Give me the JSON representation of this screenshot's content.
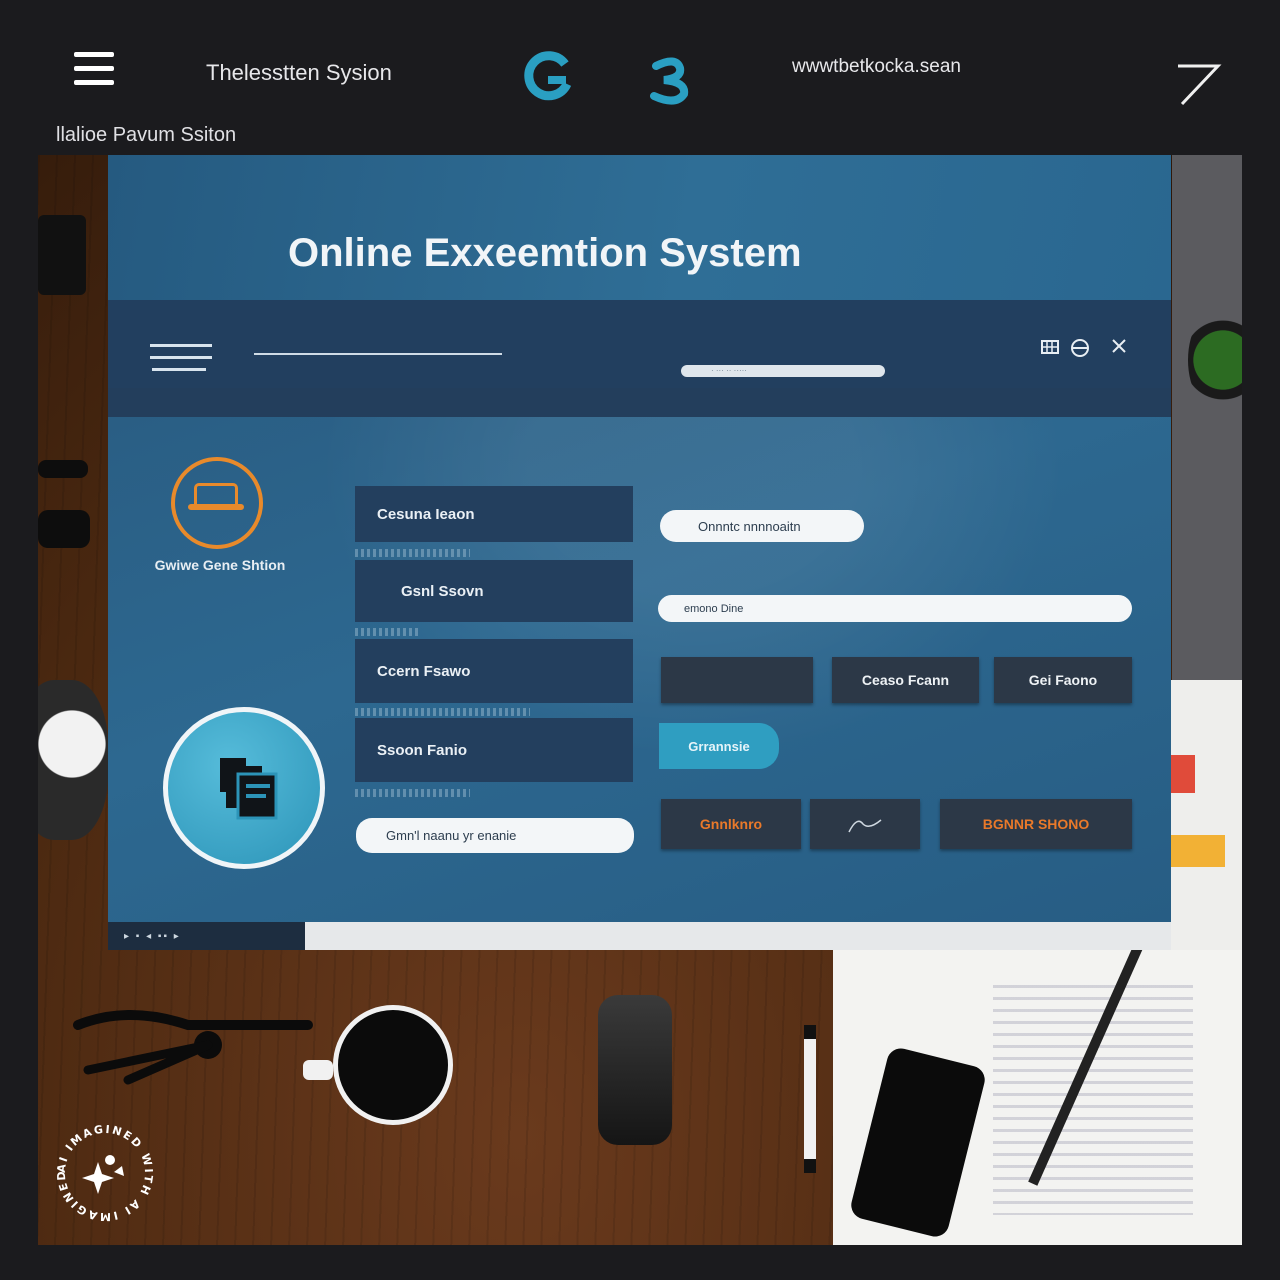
{
  "topbar": {
    "app_title": "Thelesstten Sysion",
    "site_url": "wwwtbetkocka.sean",
    "subtitle": "llalioe Pavum Ssiton"
  },
  "window": {
    "title": "Online Exxeemtion System",
    "nav_search_placeholder": "· ···  ··  ·····",
    "nav_icons": [
      "grid-icon",
      "globe-icon",
      "close-icon"
    ]
  },
  "left_panel": {
    "logo_label": "Gwiwe Gene Shtion",
    "logo_icon": "graduation-cap-icon",
    "feature_icon": "document-stack-icon"
  },
  "menu": {
    "items": [
      "Cesuna Ieaon",
      "Gsnl Ssovn",
      "Ccern Fsawo",
      "Ssoon Fanio"
    ],
    "bottom_pill": "Gmn'l naanu yr enanie"
  },
  "form": {
    "pill_button": "Onnntc nnnnoaitn",
    "input_value": "emono Dine",
    "row1": [
      "",
      "Ceaso Fcann",
      "Gei Faono"
    ],
    "teal_button": "Grrannsie",
    "row3_left": "Gnnlknro",
    "row3_right": "BGNNR  SHONO"
  },
  "status_bar": {
    "text": "▸ ▪ ◂  ▪▪ ▸"
  },
  "watermark": {
    "text": "AI IMAGINED WITH AI IMAGINED WITH"
  },
  "colors": {
    "accent_orange": "#e88a2b",
    "teal": "#2f9ec1",
    "window_blue": "#2a5d82",
    "nav_dark": "#223f5f"
  }
}
